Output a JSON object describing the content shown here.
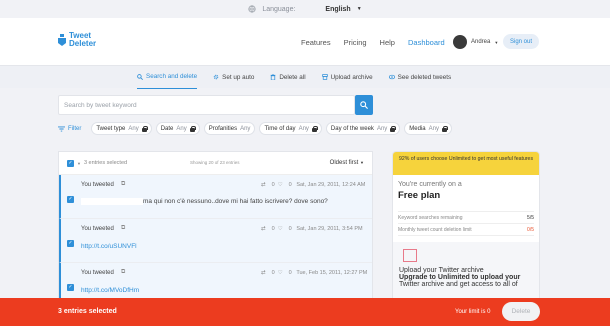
{
  "lang_bar": {
    "label": "Language:",
    "value": "English"
  },
  "brand": {
    "line1": "Tweet",
    "line2": "Deleter"
  },
  "nav": {
    "features": "Features",
    "pricing": "Pricing",
    "help": "Help",
    "dashboard": "Dashboard"
  },
  "user": {
    "name": "Andrea",
    "signout": "Sign out"
  },
  "tabs": [
    "Search and delete",
    "Set up auto",
    "Delete all",
    "Upload archive",
    "See deleted tweets"
  ],
  "search": {
    "placeholder": "Search by tweet keyword"
  },
  "filters": {
    "label": "Filter",
    "chips": [
      {
        "name": "Tweet type",
        "value": "Any"
      },
      {
        "name": "Date",
        "value": "Any"
      },
      {
        "name": "Profanities",
        "value": "Any"
      },
      {
        "name": "Time of day",
        "value": "Any"
      },
      {
        "name": "Day of the week",
        "value": "Any"
      },
      {
        "name": "Media",
        "value": "Any"
      }
    ]
  },
  "list": {
    "selected": "3 entries selected",
    "showing": "Showing 20 of 23 entries",
    "sort": "Oldest first",
    "rows": [
      {
        "who": "You tweeted",
        "rt": "0",
        "likes": "0",
        "date": "Sat, Jan 29, 2011, 12:24 AM",
        "text": "ma qui non c'è nessuno..dove mi hai fatto iscrivere? dove sono?"
      },
      {
        "who": "You tweeted",
        "rt": "0",
        "likes": "0",
        "date": "Sat, Jan 29, 2011, 3:54 PM",
        "text": "http://t.co/uSUNVFl"
      },
      {
        "who": "You tweeted",
        "rt": "0",
        "likes": "0",
        "date": "Tue, Feb 15, 2011, 12:27 PM",
        "text": "http://t.co/MVoDfHm"
      }
    ]
  },
  "panel": {
    "promo": "92% of users choose Unlimited to get most useful features",
    "current": "You're currently on a",
    "plan": "Free plan",
    "limits": [
      {
        "label": "Keyword searches remaining",
        "value": "5/5"
      },
      {
        "label": "Monthly tweet count deletion limit",
        "value": "0/5"
      }
    ],
    "upload_title": "Upload your Twitter archive",
    "upgrade": "Upgrade to Unlimited to upload your",
    "upgrade2": "Twitter archive and get access to all of"
  },
  "bottom": {
    "selected": "3 entries selected",
    "limit": "Your limit is 0",
    "delete": "Delete"
  },
  "colors": {
    "accent": "#2e8fd8",
    "bar": "#ec3c1f",
    "promo": "#f6d33c"
  }
}
